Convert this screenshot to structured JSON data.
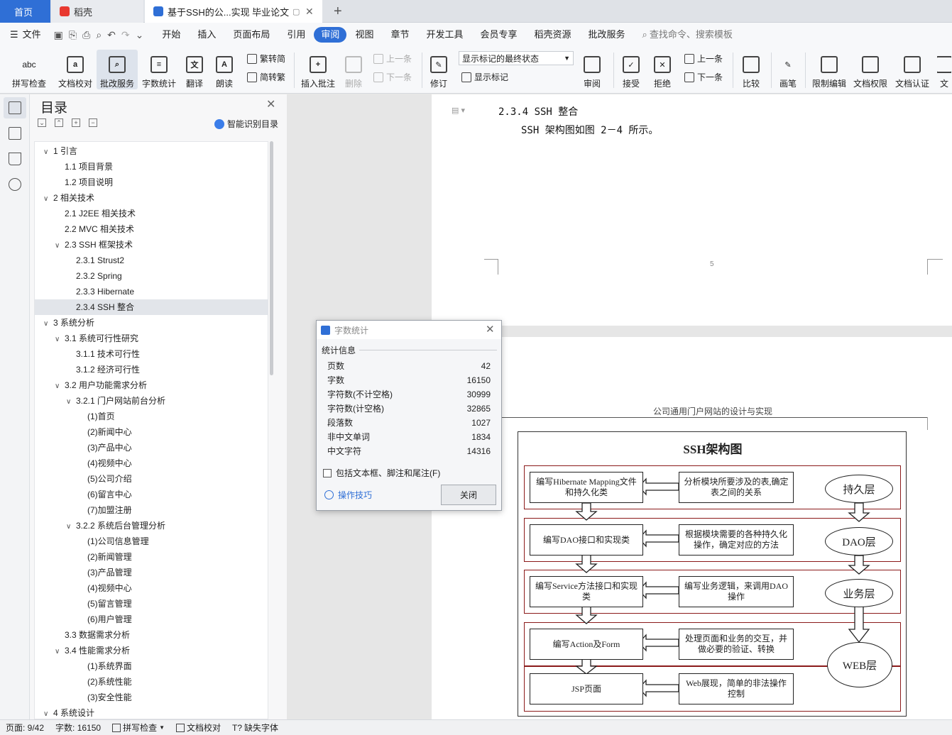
{
  "tabs": {
    "home": "首页",
    "daoke": "稻壳",
    "doc": "基于SSH的公...实现 毕业论文",
    "new_tab": "+"
  },
  "menu": {
    "file": "文件",
    "items": [
      "开始",
      "插入",
      "页面布局",
      "引用",
      "审阅",
      "视图",
      "章节",
      "开发工具",
      "会员专享",
      "稻壳资源",
      "批改服务"
    ],
    "active": "审阅",
    "search": "查找命令、搜索模板"
  },
  "ribbon": {
    "spell": "拼写检查",
    "doc_check": "文档校对",
    "correct_service": "批改服务",
    "word_count": "字数统计",
    "translate": "翻译",
    "read_aloud": "朗读",
    "trad_simp": "繁转简",
    "simp_trad": "简转繁",
    "insert_comment": "插入批注",
    "delete": "删除",
    "prev": "上一条",
    "next": "下一条",
    "revise": "修订",
    "markup_state": "显示标记的最终状态",
    "show_markup": "显示标记",
    "review": "审阅",
    "accept": "接受",
    "reject": "拒绝",
    "prev2": "上一条",
    "next2": "下一条",
    "compare": "比较",
    "pen": "画笔",
    "restrict_edit": "限制编辑",
    "doc_permission": "文档权限",
    "doc_auth": "文档认证",
    "doc_more": "文"
  },
  "toc": {
    "title": "目录",
    "smart": "智能识别目录",
    "items": [
      {
        "text": "1  引言",
        "level": 0,
        "caret": "∨"
      },
      {
        "text": "1.1  项目背景",
        "level": 1,
        "caret": ""
      },
      {
        "text": "1.2  项目说明",
        "level": 1,
        "caret": ""
      },
      {
        "text": "2  相关技术",
        "level": 0,
        "caret": "∨"
      },
      {
        "text": "2.1  J2EE 相关技术",
        "level": 1,
        "caret": ""
      },
      {
        "text": "2.2  MVC 相关技术",
        "level": 1,
        "caret": ""
      },
      {
        "text": "2.3  SSH 框架技术",
        "level": 1,
        "caret": "∨"
      },
      {
        "text": "2.3.1  Strust2",
        "level": 2,
        "caret": ""
      },
      {
        "text": "2.3.2  Spring",
        "level": 2,
        "caret": ""
      },
      {
        "text": "2.3.3  Hibernate",
        "level": 2,
        "caret": ""
      },
      {
        "text": "2.3.4  SSH 整合",
        "level": 2,
        "caret": "",
        "selected": true
      },
      {
        "text": "3  系统分析",
        "level": 0,
        "caret": "∨"
      },
      {
        "text": "3.1  系统可行性研究",
        "level": 1,
        "caret": "∨"
      },
      {
        "text": "3.1.1  技术可行性",
        "level": 2,
        "caret": ""
      },
      {
        "text": "3.1.2  经济可行性",
        "level": 2,
        "caret": ""
      },
      {
        "text": "3.2  用户功能需求分析",
        "level": 1,
        "caret": "∨"
      },
      {
        "text": "3.2.1  门户网站前台分析",
        "level": 2,
        "caret": "∨"
      },
      {
        "text": "(1)首页",
        "level": 3,
        "caret": ""
      },
      {
        "text": "(2)新闻中心",
        "level": 3,
        "caret": ""
      },
      {
        "text": "(3)产品中心",
        "level": 3,
        "caret": ""
      },
      {
        "text": "(4)视频中心",
        "level": 3,
        "caret": ""
      },
      {
        "text": "(5)公司介绍",
        "level": 3,
        "caret": ""
      },
      {
        "text": "(6)留言中心",
        "level": 3,
        "caret": ""
      },
      {
        "text": "(7)加盟注册",
        "level": 3,
        "caret": ""
      },
      {
        "text": "3.2.2  系统后台管理分析",
        "level": 2,
        "caret": "∨"
      },
      {
        "text": "(1)公司信息管理",
        "level": 3,
        "caret": ""
      },
      {
        "text": "(2)新闻管理",
        "level": 3,
        "caret": ""
      },
      {
        "text": "(3)产品管理",
        "level": 3,
        "caret": ""
      },
      {
        "text": "(4)视频中心",
        "level": 3,
        "caret": ""
      },
      {
        "text": "(5)留言管理",
        "level": 3,
        "caret": ""
      },
      {
        "text": "(6)用户管理",
        "level": 3,
        "caret": ""
      },
      {
        "text": "3.3  数据需求分析",
        "level": 1,
        "caret": ""
      },
      {
        "text": "3.4  性能需求分析",
        "level": 1,
        "caret": "∨"
      },
      {
        "text": "(1)系统界面",
        "level": 3,
        "caret": ""
      },
      {
        "text": "(2)系统性能",
        "level": 3,
        "caret": ""
      },
      {
        "text": "(3)安全性能",
        "level": 3,
        "caret": ""
      },
      {
        "text": "4  系统设计",
        "level": 0,
        "caret": "∨"
      }
    ]
  },
  "document": {
    "heading": "2.3.4   SSH 整合",
    "body": "SSH 架构图如图 2－4 所示。",
    "page_number": "5",
    "running_header": "公司通用门户网站的设计与实现"
  },
  "diagram": {
    "title": "SSH架构图",
    "left_boxes": [
      "编写Hibernate Mapping文件和持久化类",
      "编写DAO接口和实现类",
      "编写Service方法接口和实现类",
      "编写Action及Form",
      "JSP页面"
    ],
    "mid_boxes": [
      "分析模块所要涉及的表,确定表之间的关系",
      "根据模块需要的各种持久化操作，确定对应的方法",
      "编写业务逻辑，来调用DAO操作",
      "处理页面和业务的交互，并做必要的验证、转换",
      "Web展现，简单的非法操作控制"
    ],
    "layers": [
      "持久层",
      "DAO层",
      "业务层",
      "WEB层"
    ]
  },
  "dialog": {
    "title": "字数统计",
    "section": "统计信息",
    "rows": [
      {
        "label": "页数",
        "value": "42"
      },
      {
        "label": "字数",
        "value": "16150"
      },
      {
        "label": "字符数(不计空格)",
        "value": "30999"
      },
      {
        "label": "字符数(计空格)",
        "value": "32865"
      },
      {
        "label": "段落数",
        "value": "1027"
      },
      {
        "label": "非中文单词",
        "value": "1834"
      },
      {
        "label": "中文字符",
        "value": "14316"
      }
    ],
    "checkbox": "包括文本框、脚注和尾注(F)",
    "tips": "操作技巧",
    "close": "关闭"
  },
  "status": {
    "page": "页面: 9/42",
    "words": "字数: 16150",
    "spell": "拼写检查",
    "check": "文档校对",
    "missing_font": "缺失字体"
  }
}
